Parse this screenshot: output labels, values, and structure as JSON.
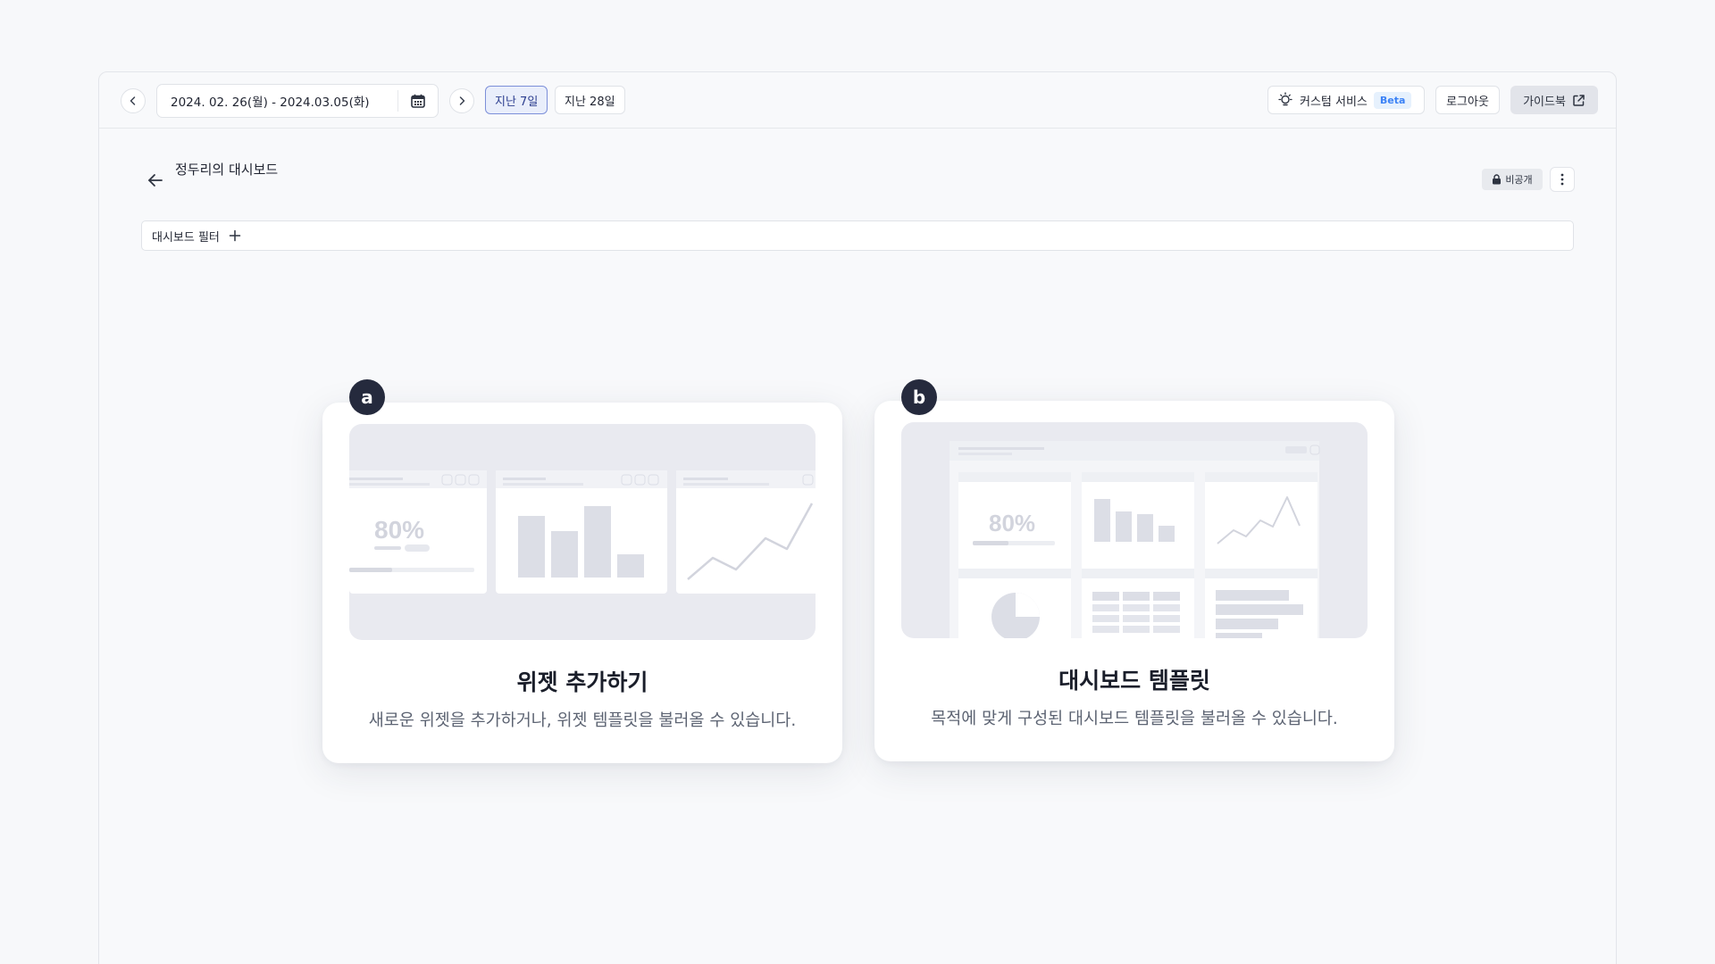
{
  "toolbar": {
    "date_range": "2024. 02. 26(월) - 2024.03.05(화)",
    "last_7_days": "지난 7일",
    "last_28_days": "지난 28일",
    "custom_service": "커스텀 서비스",
    "beta": "Beta",
    "logout": "로그아웃",
    "guidebook": "가이드북"
  },
  "page": {
    "title": "정두리의 대시보드",
    "privacy": "비공개",
    "filter_label": "대시보드 필터"
  },
  "cards": {
    "a": {
      "badge": "a",
      "title": "위젯 추가하기",
      "description": "새로운 위젯을 추가하거나, 위젯 템플릿을 불러올 수 있습니다.",
      "illustration_percent": "80%"
    },
    "b": {
      "badge": "b",
      "title": "대시보드 템플릿",
      "description": "목적에 맞게 구성된 대시보드 템플릿을 불러올 수 있습니다.",
      "illustration_percent": "80%"
    }
  },
  "colors": {
    "accent": "#7c8fd9",
    "badge_dark": "#252a3d",
    "beta_blue": "#3b82f6"
  }
}
